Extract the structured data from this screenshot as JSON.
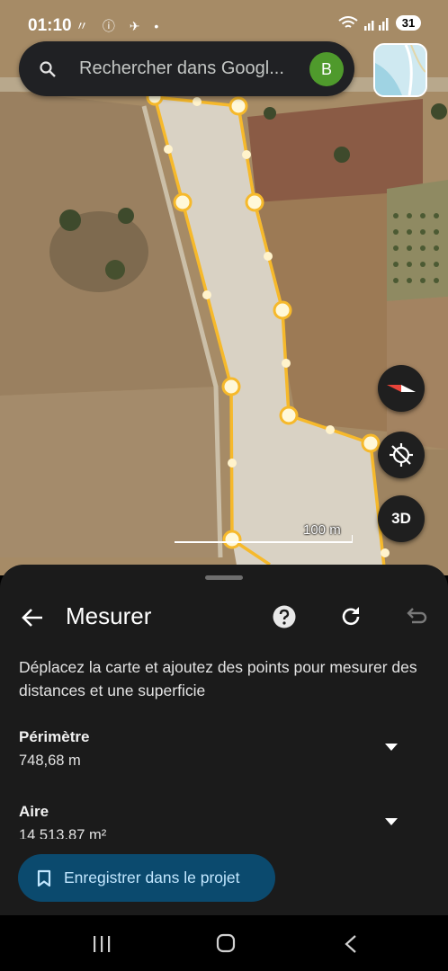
{
  "status_bar": {
    "time": "01:10",
    "battery": "31",
    "notification_icons": "〃 ⓘ ✈ •"
  },
  "search": {
    "placeholder": "Rechercher dans Googl...",
    "avatar_letter": "B"
  },
  "map": {
    "scale_label": "100 m",
    "button_3d": "3D"
  },
  "measure": {
    "title": "Mesurer",
    "instructions": "Déplacez la carte et ajoutez des points pour mesurer des distances et une superficie",
    "perimeter_label": "Périmètre",
    "perimeter_value": "748,68 m",
    "area_label": "Aire",
    "area_value": "14 513,87 m²",
    "save_label": "Enregistrer dans le projet"
  },
  "colors": {
    "measure_line": "#f6b92b",
    "save_button": "#0b4a6e",
    "sheet_bg": "#1b1b1b",
    "avatar": "#4f9a2c"
  }
}
